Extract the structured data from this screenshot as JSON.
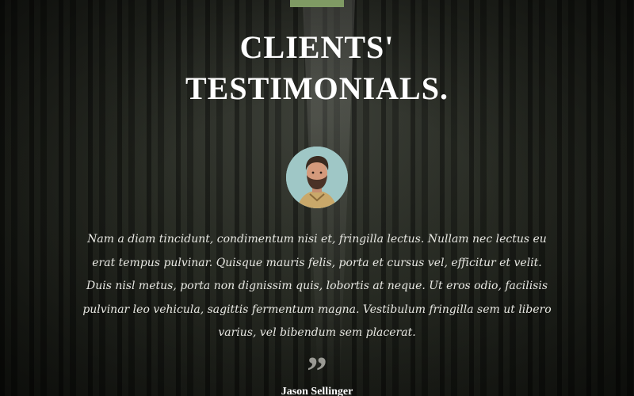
{
  "section": {
    "title_line1": "CLIENTS'",
    "title_line2": "TESTIMONIALS.",
    "accent_color": "#7f9a64",
    "background": "dark pine forest photo"
  },
  "testimonial": {
    "avatar_icon": "client-portrait",
    "text": "Nam a diam tincidunt, condimentum nisi et, fringilla lectus. Nullam nec lectus eu erat tempus pulvinar. Quisque mauris felis, porta et cursus vel, efficitur et velit. Duis nisl metus, porta non dignissim quis, lobortis at neque. Ut eros odio, facilisis pulvinar leo vehicula, sagittis fermentum magna. Vestibulum fringilla sem ut libero varius, vel bibendum sem placerat.",
    "quote_icon": "quote-icon",
    "quote_glyph": "”",
    "client_name": "Jason Sellinger"
  }
}
